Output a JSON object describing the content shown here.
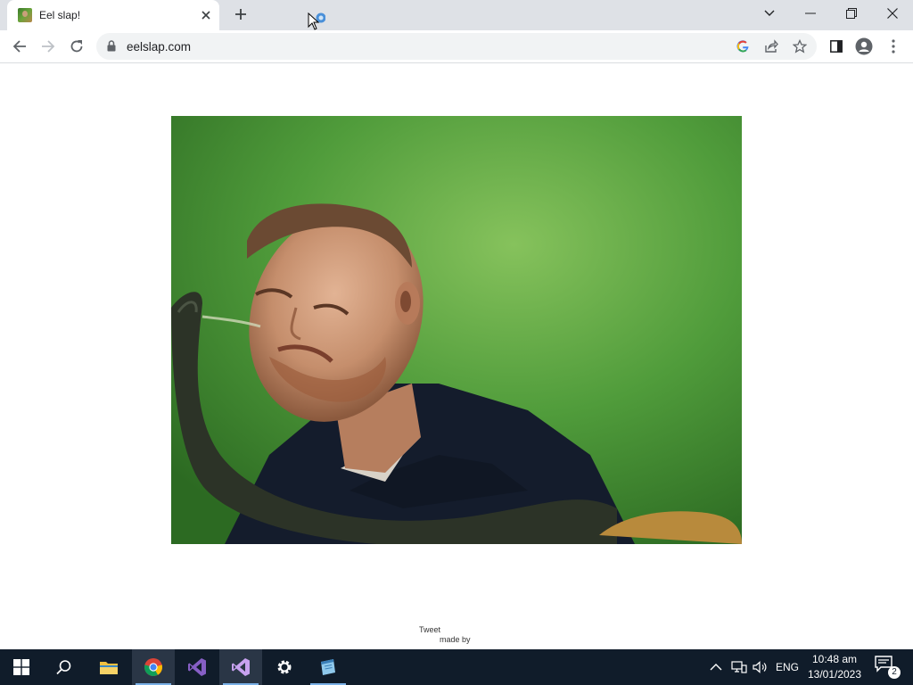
{
  "browser": {
    "tab_title": "Eel slap!",
    "url": "eelslap.com"
  },
  "page": {
    "tweet_label": "Tweet",
    "made_by_label": "made by"
  },
  "taskbar": {
    "language": "ENG",
    "time": "10:48 am",
    "date": "13/01/2023",
    "notification_count": "2"
  }
}
